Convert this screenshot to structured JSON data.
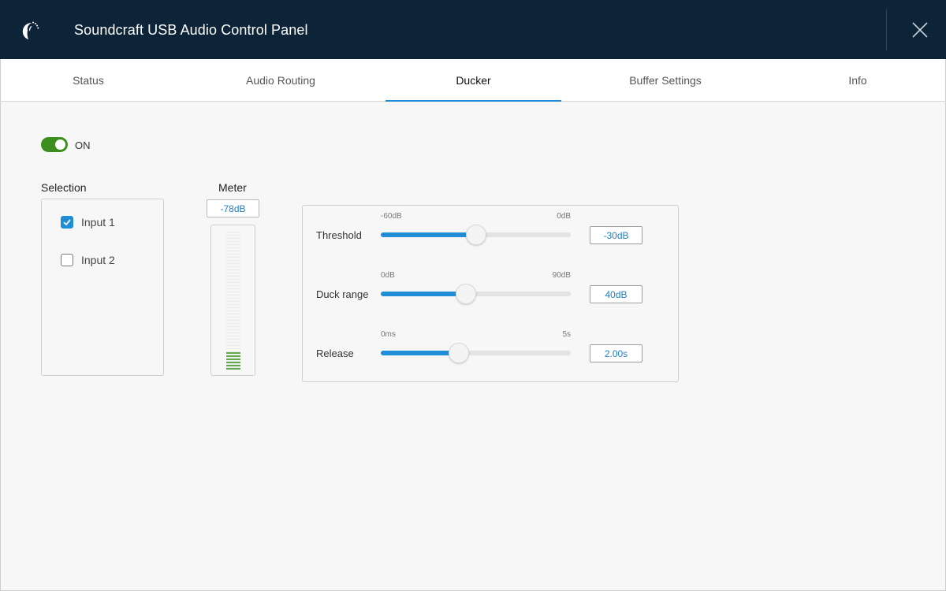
{
  "app": {
    "title": "Soundcraft USB Audio Control Panel"
  },
  "tabs": [
    {
      "label": "Status"
    },
    {
      "label": "Audio Routing"
    },
    {
      "label": "Ducker",
      "active": true
    },
    {
      "label": "Buffer Settings"
    },
    {
      "label": "Info"
    }
  ],
  "ducker": {
    "enabled": true,
    "toggle_label": "ON",
    "selection": {
      "title": "Selection",
      "inputs": [
        {
          "label": "Input 1",
          "checked": true
        },
        {
          "label": "Input 2",
          "checked": false
        }
      ]
    },
    "meter": {
      "title": "Meter",
      "value": "-78dB",
      "level_fraction": 0.13
    },
    "params": [
      {
        "name": "Threshold",
        "min": "-60dB",
        "max": "0dB",
        "value": "-30dB",
        "fraction": 0.5
      },
      {
        "name": "Duck range",
        "min": "0dB",
        "max": "90dB",
        "value": "40dB",
        "fraction": 0.45
      },
      {
        "name": "Release",
        "min": "0ms",
        "max": "5s",
        "value": "2.00s",
        "fraction": 0.41
      }
    ]
  },
  "colors": {
    "titlebar": "#0d2438",
    "accent": "#1f8ed6",
    "toggle_on": "#3c8f1f",
    "meter": "#5faa4a"
  },
  "icons": {
    "logo": "soundcraft-logo-icon",
    "close": "close-icon"
  }
}
